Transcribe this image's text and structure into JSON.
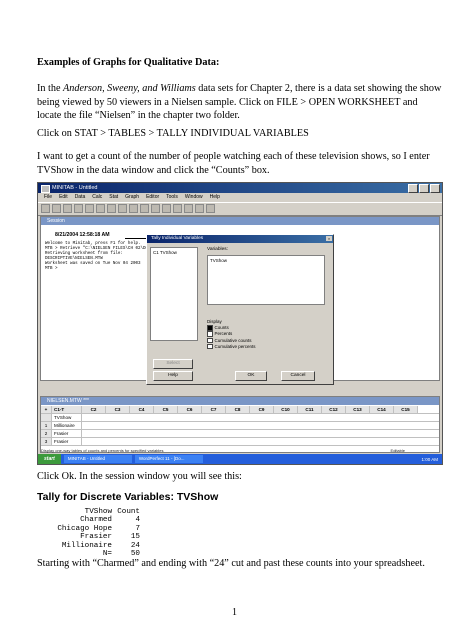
{
  "heading": "Examples of Graphs for Qualitative Data:",
  "para1": {
    "before": "In the ",
    "italic": "Anderson, Sweeny, and Williams",
    "after": " data sets for Chapter 2, there is a data set showing the show being viewed by 50 viewers in a Nielsen sample.  Click on FILE > OPEN WORKSHEET and locate the file “Nielsen” in the chapter two folder."
  },
  "para2": "Click on STAT > TABLES > TALLY INDIVIDUAL VARIABLES",
  "para3": "I want to get a count of the number of people watching each of these television shows, so I enter TVShow in the data window and click the “Counts” box.",
  "screenshot": {
    "app_title": "MINITAB - Untitled",
    "menu": [
      "File",
      "Edit",
      "Data",
      "Calc",
      "Stat",
      "Graph",
      "Editor",
      "Tools",
      "Window",
      "Help"
    ],
    "session_title": "Session",
    "session_date": "8/21/2004 12:58:18 AM",
    "session_text": "Welcome to Minitab, press F1 for help.\nMTB > Retrieve \"C:\\NIELSEN FILES\\CH 02\\DESCRIPTIVE\\NIELSEN.MTW\"\nRetrieving worksheet from file:\nDESCRIPTIVE\\NIELSEN.MTW\nWorksheet was saved on Tue Nov 04 2003\nMTB >",
    "dialog": {
      "title": "Tally Individual Variables",
      "list_item": "C1    TVShow",
      "variables_label": "Variables:",
      "variables_value": "TVShow",
      "display_label": "Display",
      "options": [
        {
          "label": "Counts",
          "checked": true
        },
        {
          "label": "Percents",
          "checked": false
        },
        {
          "label": "Cumulative counts",
          "checked": false
        },
        {
          "label": "Cumulative percents",
          "checked": false
        }
      ],
      "select": "Select",
      "help": "Help",
      "ok": "OK",
      "cancel": "Cancel"
    },
    "worksheet_title": "NIELSEN.MTW ***",
    "columns": [
      "+",
      "C1-T",
      "C2",
      "C3",
      "C4",
      "C5",
      "C6",
      "C7",
      "C8",
      "C9",
      "C10",
      "C11",
      "C12",
      "C13",
      "C14",
      "C15"
    ],
    "rows": [
      {
        "n": "",
        "c1": "TVShow"
      },
      {
        "n": "1",
        "c1": "Millionaire"
      },
      {
        "n": "2",
        "c1": "Frasier"
      },
      {
        "n": "3",
        "c1": "Frasier"
      }
    ],
    "status": "Display one-way tables of counts and percents for specified variables",
    "status_right": "Editable",
    "start": "start",
    "tasks": [
      "MINITAB - Untitled",
      "WordPerfect 11 - [Do..."
    ],
    "clock": "1:00 AM"
  },
  "para4": "Click Ok.  In the session window you will see this:",
  "tally_title": "Tally for Discrete Variables: TVShow",
  "tally": {
    "header": [
      "TVShow",
      "Count"
    ],
    "rows": [
      [
        "Charmed",
        "4"
      ],
      [
        "Chicago Hope",
        "7"
      ],
      [
        "Frasier",
        "15"
      ],
      [
        "Millionaire",
        "24"
      ],
      [
        "N=",
        "50"
      ]
    ]
  },
  "para5": "Starting with “Charmed” and ending with “24” cut and past these counts into your spreadsheet.",
  "page_number": "1"
}
